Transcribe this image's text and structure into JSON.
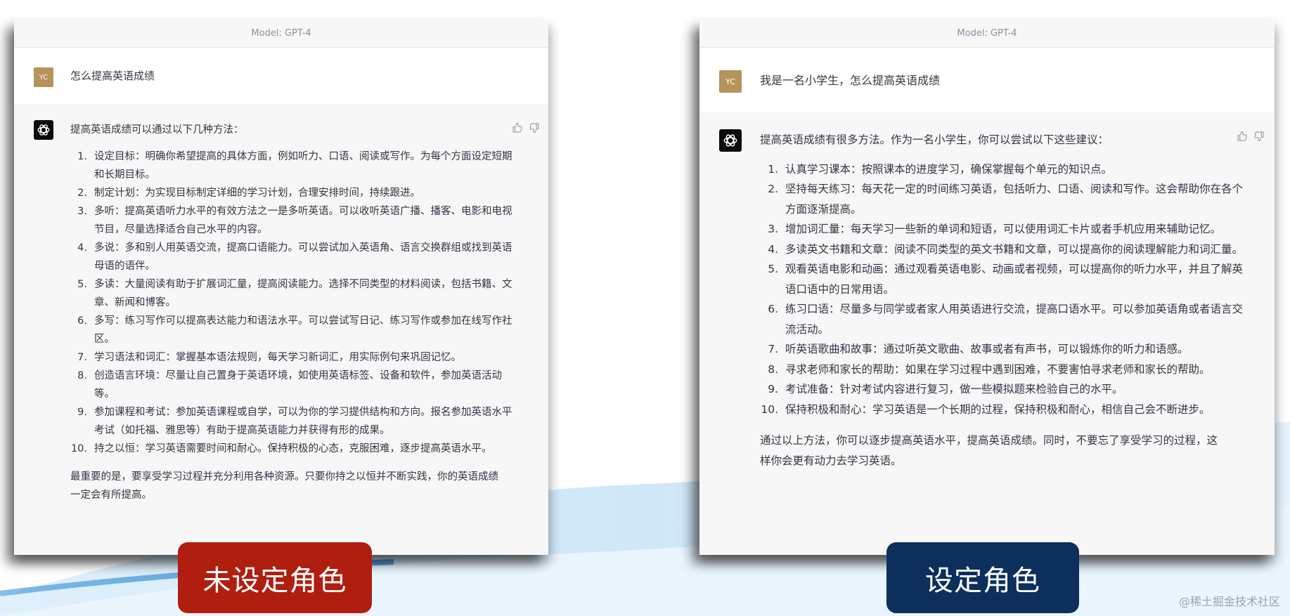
{
  "colors": {
    "label_left_bg": "#b01e10",
    "label_right_bg": "#0c2f5c",
    "avatar_bg": "#b4945b",
    "chat_bg": "#f7f7f8",
    "user_bg": "#ffffff"
  },
  "left_panel": {
    "model_label": "Model: GPT-4",
    "user": {
      "avatar_text": "YC",
      "message": "怎么提高英语成绩"
    },
    "assistant": {
      "intro": "提高英语成绩可以通过以下几种方法：",
      "items": [
        {
          "num": "1.",
          "text": "设定目标：明确你希望提高的具体方面，例如听力、口语、阅读或写作。为每个方面设定短期和长期目标。"
        },
        {
          "num": "2.",
          "text": "制定计划：为实现目标制定详细的学习计划，合理安排时间，持续跟进。"
        },
        {
          "num": "3.",
          "text": "多听：提高英语听力水平的有效方法之一是多听英语。可以收听英语广播、播客、电影和电视节目，尽量选择适合自己水平的内容。"
        },
        {
          "num": "4.",
          "text": "多说：多和别人用英语交流，提高口语能力。可以尝试加入英语角、语言交换群组或找到英语母语的语伴。"
        },
        {
          "num": "5.",
          "text": "多读：大量阅读有助于扩展词汇量，提高阅读能力。选择不同类型的材料阅读，包括书籍、文章、新闻和博客。"
        },
        {
          "num": "6.",
          "text": "多写：练习写作可以提高表达能力和语法水平。可以尝试写日记、练习写作或参加在线写作社区。"
        },
        {
          "num": "7.",
          "text": "学习语法和词汇：掌握基本语法规则，每天学习新词汇，用实际例句来巩固记忆。"
        },
        {
          "num": "8.",
          "text": "创造语言环境：尽量让自己置身于英语环境，如使用英语标签、设备和软件，参加英语活动等。"
        },
        {
          "num": "9.",
          "text": "参加课程和考试：参加英语课程或自学，可以为你的学习提供结构和方向。报名参加英语水平考试（如托福、雅思等）有助于提高英语能力并获得有形的成果。"
        },
        {
          "num": "10.",
          "text": "持之以恒：学习英语需要时间和耐心。保持积极的心态，克服困难，逐步提高英语水平。"
        }
      ],
      "conclusion": "最重要的是，要享受学习过程并充分利用各种资源。只要你持之以恒并不断实践，你的英语成绩一定会有所提高。"
    }
  },
  "right_panel": {
    "model_label": "Model: GPT-4",
    "user": {
      "avatar_text": "YC",
      "message": "我是一名小学生，怎么提高英语成绩"
    },
    "assistant": {
      "intro": "提高英语成绩有很多方法。作为一名小学生，你可以尝试以下这些建议：",
      "items": [
        {
          "num": "1.",
          "text": "认真学习课本：按照课本的进度学习，确保掌握每个单元的知识点。"
        },
        {
          "num": "2.",
          "text": "坚持每天练习：每天花一定的时间练习英语，包括听力、口语、阅读和写作。这会帮助你在各个方面逐渐提高。"
        },
        {
          "num": "3.",
          "text": "增加词汇量：每天学习一些新的单词和短语，可以使用词汇卡片或者手机应用来辅助记忆。"
        },
        {
          "num": "4.",
          "text": "多读英文书籍和文章：阅读不同类型的英文书籍和文章，可以提高你的阅读理解能力和词汇量。"
        },
        {
          "num": "5.",
          "text": "观看英语电影和动画：通过观看英语电影、动画或者视频，可以提高你的听力水平，并且了解英语口语中的日常用语。"
        },
        {
          "num": "6.",
          "text": "练习口语：尽量多与同学或者家人用英语进行交流，提高口语水平。可以参加英语角或者语言交流活动。"
        },
        {
          "num": "7.",
          "text": "听英语歌曲和故事：通过听英文歌曲、故事或者有声书，可以锻炼你的听力和语感。"
        },
        {
          "num": "8.",
          "text": "寻求老师和家长的帮助：如果在学习过程中遇到困难，不要害怕寻求老师和家长的帮助。"
        },
        {
          "num": "9.",
          "text": "考试准备：针对考试内容进行复习，做一些模拟题来检验自己的水平。"
        },
        {
          "num": "10.",
          "text": "保持积极和耐心：学习英语是一个长期的过程，保持积极和耐心，相信自己会不断进步。"
        }
      ],
      "conclusion": "通过以上方法，你可以逐步提高英语水平，提高英语成绩。同时，不要忘了享受学习的过程，这样你会更有动力去学习英语。"
    }
  },
  "labels": {
    "left": "未设定角色",
    "right": "设定角色"
  },
  "watermark": "@稀土掘金技术社区"
}
